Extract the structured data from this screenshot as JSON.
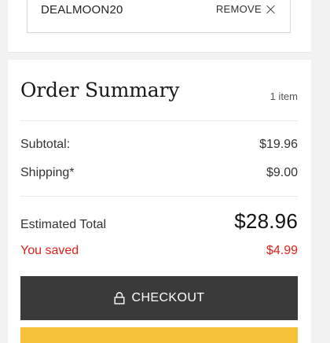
{
  "promo": {
    "code": "DEALMOON20",
    "remove_label": "REMOVE"
  },
  "summary": {
    "title": "Order Summary",
    "item_count": "1 item",
    "rows": [
      {
        "label": "Subtotal:",
        "value": "$19.96"
      },
      {
        "label": "Shipping*",
        "value": "$9.00"
      }
    ],
    "total": {
      "label": "Estimated Total",
      "value": "$28.96"
    },
    "saved": {
      "label": "You saved",
      "value": "$4.99"
    },
    "checkout_label": "CHECKOUT"
  },
  "colors": {
    "accent_red": "#e0201b",
    "checkout_bg": "#3a3a3a",
    "paypal_yellow": "#f7c13a"
  },
  "icons": {
    "remove": "close-icon",
    "checkout": "lock-icon"
  }
}
